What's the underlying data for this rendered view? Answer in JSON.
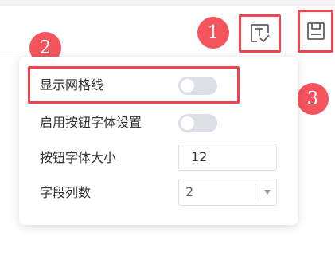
{
  "toolbar": {
    "text_settings_button": "text-settings-icon",
    "save_button": "save-icon"
  },
  "markers": [
    "1",
    "2",
    "3"
  ],
  "settings_panel": {
    "show_grid_label": "显示网格线",
    "show_grid_enabled": false,
    "enable_button_font_label": "启用按钮字体设置",
    "enable_button_font_enabled": false,
    "button_font_size_label": "按钮字体大小",
    "button_font_size_value": "12",
    "field_columns_label": "字段列数",
    "field_columns_value": "2"
  },
  "colors": {
    "highlight": "#f2434f",
    "marker": "#f5545c",
    "switch_off": "#dcdfe6",
    "icon": "#5f5f5f"
  }
}
